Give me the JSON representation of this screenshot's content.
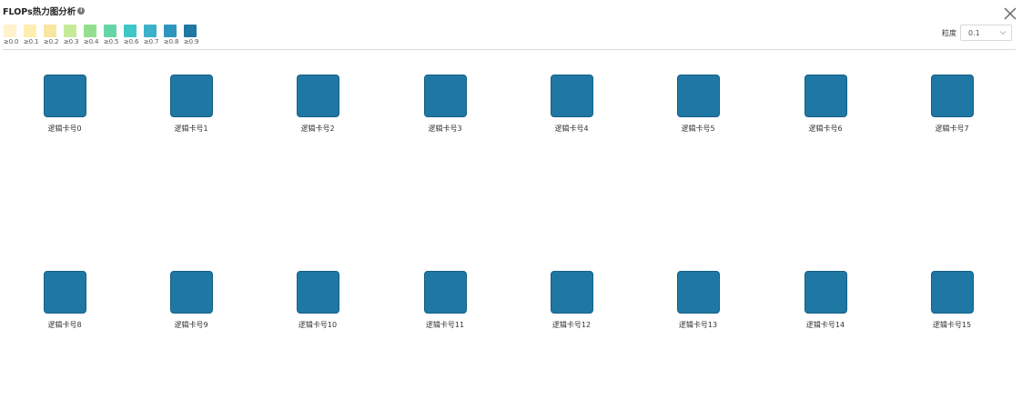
{
  "header": {
    "title": "FLOPs热力图分析",
    "info_icon": "i"
  },
  "legend": {
    "items": [
      {
        "label": "≥0.0",
        "color": "#fff2cc"
      },
      {
        "label": "≥0.1",
        "color": "#ffeeb0"
      },
      {
        "label": "≥0.2",
        "color": "#f7e7a0"
      },
      {
        "label": "≥0.3",
        "color": "#c7ea98"
      },
      {
        "label": "≥0.4",
        "color": "#93df8f"
      },
      {
        "label": "≥0.5",
        "color": "#66d6a9"
      },
      {
        "label": "≥0.6",
        "color": "#3fc6c6"
      },
      {
        "label": "≥0.7",
        "color": "#3cb1c9"
      },
      {
        "label": "≥0.8",
        "color": "#2e96bd"
      },
      {
        "label": "≥0.9",
        "color": "#1f77a4"
      }
    ]
  },
  "granularity": {
    "label": "粒度",
    "value": "0.1"
  },
  "cards": [
    {
      "label": "逻辑卡号0",
      "color": "#1f77a4"
    },
    {
      "label": "逻辑卡号1",
      "color": "#1f77a4"
    },
    {
      "label": "逻辑卡号2",
      "color": "#1f77a4"
    },
    {
      "label": "逻辑卡号3",
      "color": "#1f77a4"
    },
    {
      "label": "逻辑卡号4",
      "color": "#1f77a4"
    },
    {
      "label": "逻辑卡号5",
      "color": "#1f77a4"
    },
    {
      "label": "逻辑卡号6",
      "color": "#1f77a4"
    },
    {
      "label": "逻辑卡号7",
      "color": "#1f77a4"
    },
    {
      "label": "逻辑卡号8",
      "color": "#1f77a4"
    },
    {
      "label": "逻辑卡号9",
      "color": "#1f77a4"
    },
    {
      "label": "逻辑卡号10",
      "color": "#1f77a4"
    },
    {
      "label": "逻辑卡号11",
      "color": "#1f77a4"
    },
    {
      "label": "逻辑卡号12",
      "color": "#1f77a4"
    },
    {
      "label": "逻辑卡号13",
      "color": "#1f77a4"
    },
    {
      "label": "逻辑卡号14",
      "color": "#1f77a4"
    },
    {
      "label": "逻辑卡号15",
      "color": "#1f77a4"
    }
  ]
}
